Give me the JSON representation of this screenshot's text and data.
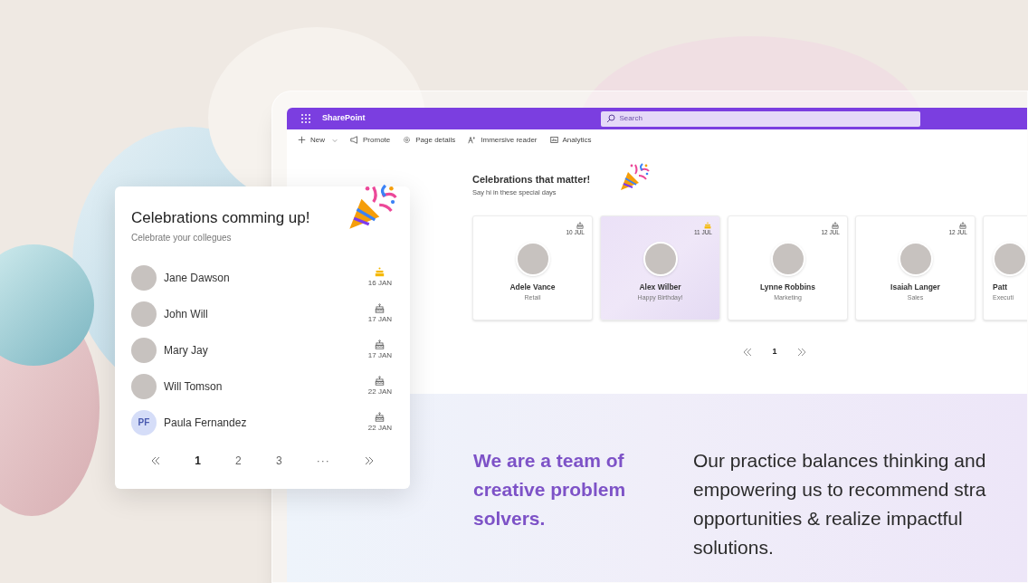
{
  "app": {
    "name": "SharePoint",
    "search_placeholder": "Search"
  },
  "command_bar": [
    {
      "kind": "new",
      "label": "New"
    },
    {
      "kind": "promote",
      "label": "Promote"
    },
    {
      "kind": "details",
      "label": "Page details"
    },
    {
      "kind": "reader",
      "label": "Immersive reader"
    },
    {
      "kind": "analytics",
      "label": "Analytics"
    }
  ],
  "celebrations": {
    "title": "Celebrations that matter!",
    "subtitle": "Say hi in these special days",
    "cards": [
      {
        "name": "Adele Vance",
        "detail": "Retail",
        "date": "10 JUL",
        "today": false
      },
      {
        "name": "Alex Wilber",
        "detail": "Happy Birthday!",
        "date": "11 JUL",
        "today": true
      },
      {
        "name": "Lynne Robbins",
        "detail": "Marketing",
        "date": "12 JUL",
        "today": false
      },
      {
        "name": "Isaiah Langer",
        "detail": "Sales",
        "date": "12 JUL",
        "today": false
      },
      {
        "name": "Patt",
        "detail": "Executi",
        "today": false
      }
    ],
    "pages": [
      {
        "kind": "prev",
        "selected": false
      },
      {
        "label": "1",
        "kind": "page",
        "selected": true
      },
      {
        "kind": "next",
        "selected": false
      }
    ]
  },
  "about": {
    "heading": "We are a team of creative problem solvers.",
    "lines": [
      "Our practice balances thinking and",
      "empowering us to recommend stra",
      "opportunities & realize impactful",
      "solutions."
    ]
  },
  "upcoming": {
    "title": "Celebrations comming up!",
    "subtitle": "Celebrate your collegues",
    "people": [
      {
        "name": "Jane Dawson",
        "date": "16 JAN",
        "today": true
      },
      {
        "name": "John Will",
        "date": "17 JAN",
        "today": false
      },
      {
        "name": "Mary Jay",
        "date": "17 JAN",
        "today": false
      },
      {
        "name": "Will Tomson",
        "date": "22 JAN",
        "today": false
      },
      {
        "name": "Paula Fernandez",
        "initials": "PF",
        "date": "22 JAN",
        "today": false
      }
    ],
    "pages": [
      {
        "kind": "prev",
        "selected": false
      },
      {
        "label": "1",
        "kind": "page",
        "selected": true
      },
      {
        "label": "2",
        "kind": "page",
        "selected": false
      },
      {
        "label": "3",
        "kind": "page",
        "selected": false
      },
      {
        "label": "···",
        "kind": "more",
        "selected": false
      },
      {
        "kind": "next",
        "selected": false
      }
    ]
  }
}
